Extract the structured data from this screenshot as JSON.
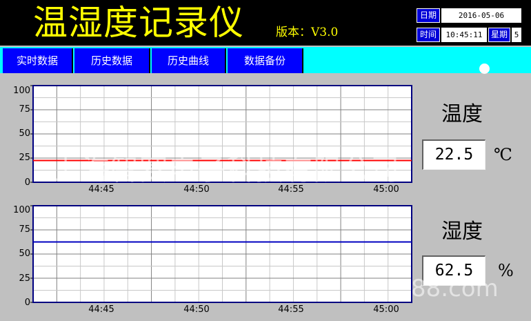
{
  "header": {
    "title": "温湿度记录仪",
    "version": "版本：V3.0",
    "date_label": "日期",
    "date_value": "2016-05-06",
    "time_label": "时间",
    "time_value": "10:45:11",
    "weekday_label": "星期",
    "weekday_value": "5"
  },
  "nav": {
    "tabs": [
      {
        "label": "实时数据"
      },
      {
        "label": "历史数据"
      },
      {
        "label": "历史曲线"
      },
      {
        "label": "数据备份"
      }
    ]
  },
  "temperature": {
    "title": "温度",
    "value": "22.5",
    "unit": "℃"
  },
  "humidity": {
    "title": "湿度",
    "value": "62.5",
    "unit": "%"
  },
  "watermark": {
    "company": "上海智赛电子科技有限公司",
    "site": "88.com"
  },
  "colors": {
    "header_bg": "#000000",
    "title_yellow": "#ffff00",
    "tab_blue": "#0000ff",
    "nav_cyan": "#00ffff",
    "temp_line": "#ff0000",
    "humid_line": "#0000c0"
  },
  "chart_data": [
    {
      "type": "line",
      "x": [
        "44:45",
        "44:50",
        "44:55",
        "45:00"
      ],
      "ylim": [
        0,
        100
      ],
      "yticks": [
        "100",
        "75",
        "50",
        "25",
        "0"
      ],
      "series": [
        {
          "values": [
            22.5,
            22.5,
            22.5,
            22.5
          ]
        }
      ]
    },
    {
      "type": "line",
      "x": [
        "44:45",
        "44:50",
        "44:55",
        "45:00"
      ],
      "ylim": [
        0,
        100
      ],
      "yticks": [
        "100",
        "75",
        "50",
        "25",
        "0"
      ],
      "series": [
        {
          "values": [
            62.5,
            62.5,
            62.5,
            62.5
          ]
        }
      ]
    }
  ]
}
